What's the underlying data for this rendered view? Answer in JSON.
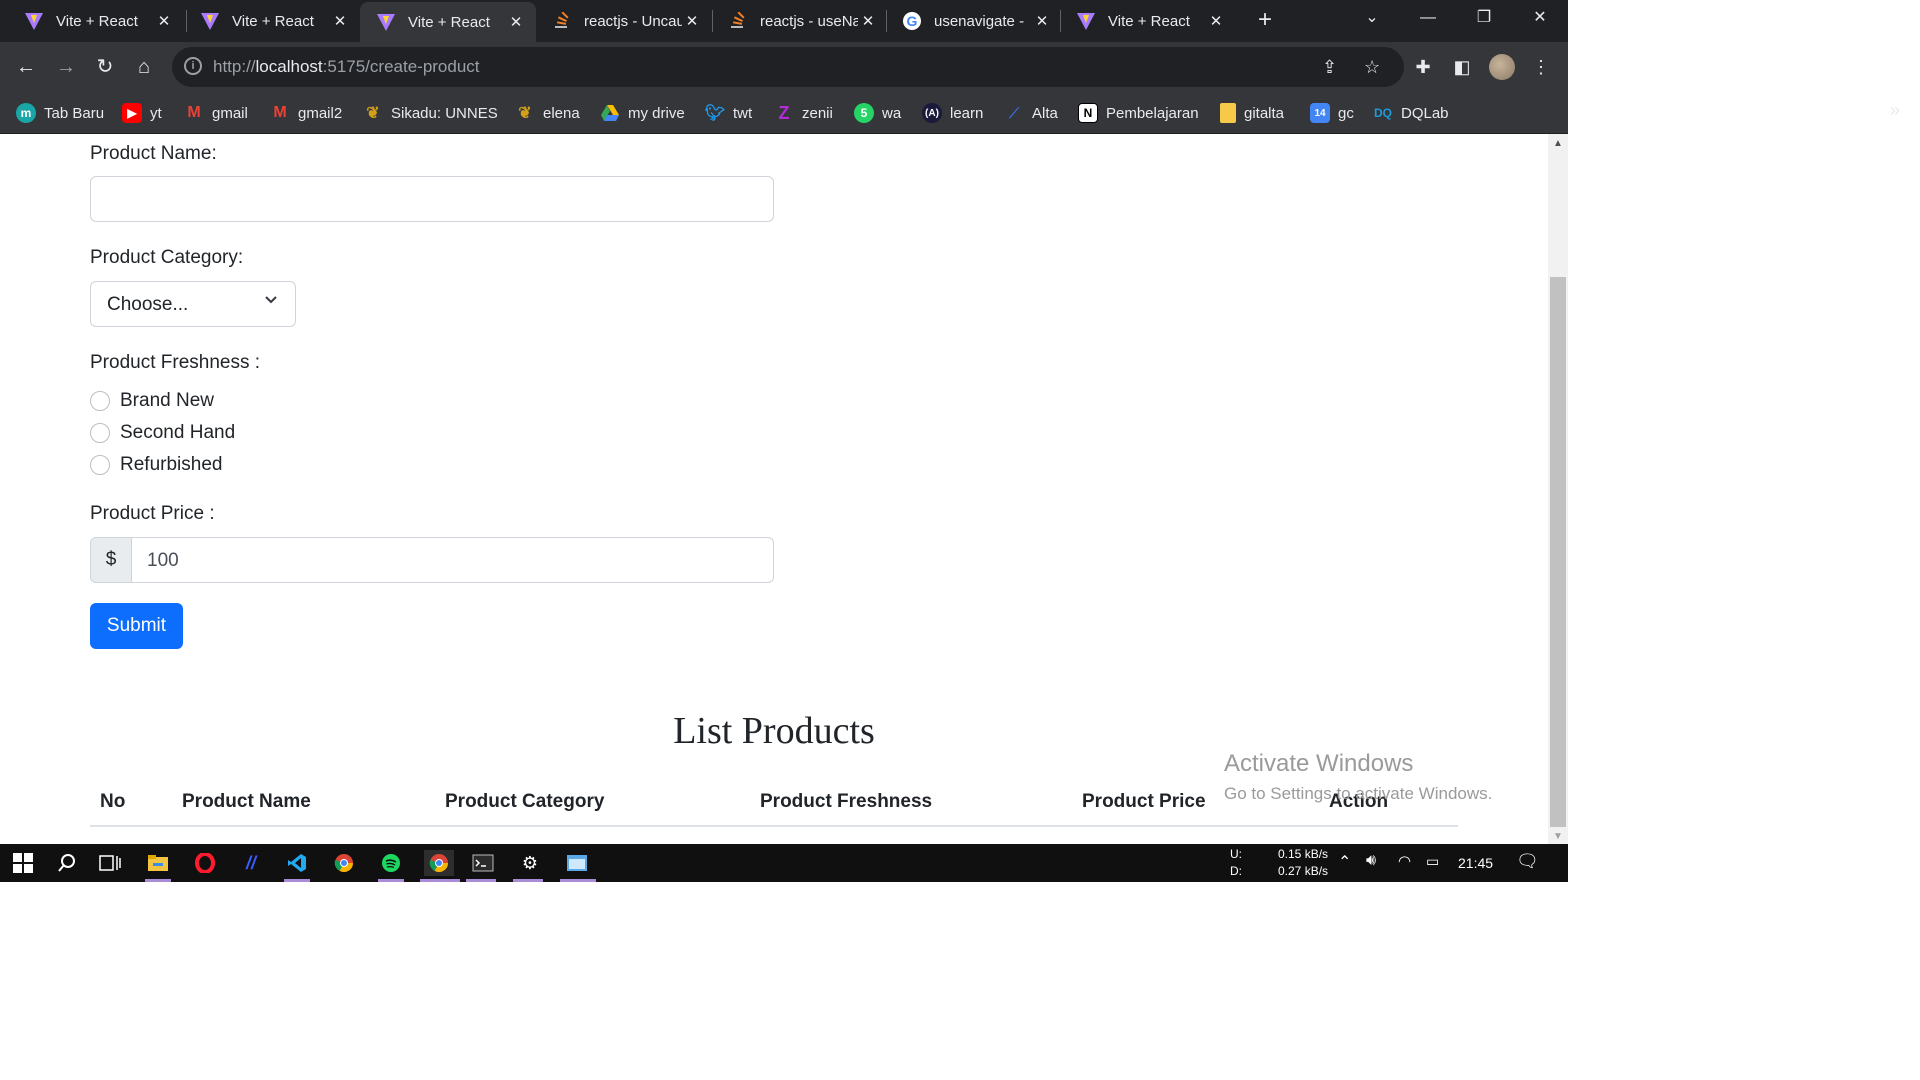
{
  "browser": {
    "tabs": [
      {
        "title": "Vite + React",
        "icon": "vite-icon",
        "active": false
      },
      {
        "title": "Vite + React",
        "icon": "vite-icon",
        "active": false
      },
      {
        "title": "Vite + React",
        "icon": "vite-icon",
        "active": true
      },
      {
        "title": "reactjs - Uncau",
        "icon": "stackoverflow-icon",
        "active": false
      },
      {
        "title": "reactjs - useNa",
        "icon": "stackoverflow-icon",
        "active": false
      },
      {
        "title": "usenavigate -",
        "icon": "google-icon",
        "active": false
      },
      {
        "title": "Vite + React",
        "icon": "vite-icon",
        "active": false
      }
    ],
    "url_prefix": "http://",
    "url_host": "localhost",
    "url_rest": ":5175/create-product",
    "bookmarks": [
      {
        "label": "Tab Baru",
        "icon": "tab-baru-icon",
        "color": "#1aa6a6"
      },
      {
        "label": "yt",
        "icon": "youtube-icon",
        "color": "#ff0000"
      },
      {
        "label": "gmail",
        "icon": "gmail-icon",
        "color": "#ea4335"
      },
      {
        "label": "gmail2",
        "icon": "gmail-icon",
        "color": "#ea4335"
      },
      {
        "label": "Sikadu: UNNES",
        "icon": "unnes-icon",
        "color": "#d4a017"
      },
      {
        "label": "elena",
        "icon": "unnes-icon",
        "color": "#d4a017"
      },
      {
        "label": "my drive",
        "icon": "drive-icon",
        "color": "#34a853"
      },
      {
        "label": "twt",
        "icon": "twitter-icon",
        "color": "#1d9bf0"
      },
      {
        "label": "zenii",
        "icon": "zenius-icon",
        "color": "#b12bd6"
      },
      {
        "label": "wa",
        "icon": "whatsapp-icon",
        "color": "#25d366"
      },
      {
        "label": "learn",
        "icon": "learn-icon",
        "color": "#1a1a3a"
      },
      {
        "label": "Alta",
        "icon": "alta-icon",
        "color": "#3a6ad6"
      },
      {
        "label": "Pembelajaran",
        "icon": "notion-icon",
        "color": "#ffffff"
      },
      {
        "label": "gitalta",
        "icon": "folder-icon",
        "color": "#f7c948"
      },
      {
        "label": "gc",
        "icon": "classroom-icon",
        "color": "#4285f4"
      },
      {
        "label": "DQLab",
        "icon": "dqlab-icon",
        "color": "#1f9ad6"
      }
    ]
  },
  "form": {
    "product_name_label": "Product Name:",
    "product_name_value": "",
    "category_label": "Product Category:",
    "category_selected": "Choose...",
    "freshness_label": "Product Freshness :",
    "freshness_options": [
      "Brand New",
      "Second Hand",
      "Refurbished"
    ],
    "price_label": "Product Price :",
    "price_prefix": "$",
    "price_placeholder": "100",
    "submit_label": "Submit"
  },
  "list": {
    "title": "List Products",
    "columns": [
      "No",
      "Product Name",
      "Product Category",
      "Product Freshness",
      "Product Price",
      "Action"
    ]
  },
  "watermark": {
    "line1": "Activate Windows",
    "line2": "Go to Settings to activate Windows."
  },
  "taskbar": {
    "upload_label": "U:",
    "download_label": "D:",
    "upload_speed": "0.15 kB/s",
    "download_speed": "0.27 kB/s",
    "time": "21:45"
  },
  "colors": {
    "primary": "#0d6efd",
    "tab_bg": "#202124",
    "toolbar_bg": "#35363a"
  }
}
